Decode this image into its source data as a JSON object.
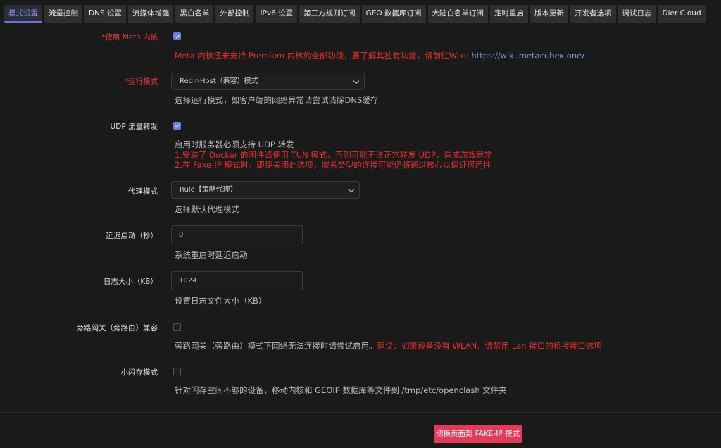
{
  "tabs": [
    {
      "label": "模式设置"
    },
    {
      "label": "流量控制"
    },
    {
      "label": "DNS 设置"
    },
    {
      "label": "流媒体增强"
    },
    {
      "label": "黑白名单"
    },
    {
      "label": "外部控制"
    },
    {
      "label": "IPv6 设置"
    },
    {
      "label": "第三方规则订阅"
    },
    {
      "label": "GEO 数据库订阅"
    },
    {
      "label": "大陆白名单订阅"
    },
    {
      "label": "定时重启"
    },
    {
      "label": "版本更新"
    },
    {
      "label": "开发者选项"
    },
    {
      "label": "调试日志"
    },
    {
      "label": "Dler Cloud"
    }
  ],
  "active_tab": "模式设置",
  "fields": {
    "meta": {
      "label": "*使用 Meta 内核",
      "checked": true,
      "desc_red": "Meta 内核还未支持 Premium 内核的全部功能，要了解其独有功能，请前往Wiki: ",
      "desc_link": "https://wiki.metacubex.one/"
    },
    "run_mode": {
      "label": "*运行模式",
      "value": "Redir-Host（兼容）模式",
      "desc": "选择运行模式，如客户端的网络异常请尝试清除DNS缓存"
    },
    "udp": {
      "label": "UDP 流量转发",
      "checked": true,
      "desc": "启用时服务器必须支持 UDP 转发",
      "warn1": "1.安装了 Docker 的固件请使用 TUN 模式，否则可能无法正常转发 UDP，造成游戏异常",
      "warn2": "2.在 Fake-IP 模式时，即使关闭此选项，域名类型的连接可能仍将通过核心以保证可用性"
    },
    "proxy_mode": {
      "label": "代理模式",
      "value": "Rule【策略代理】",
      "desc": "选择默认代理模式"
    },
    "start_delay": {
      "label": "延迟启动（秒）",
      "value": "0",
      "desc": "系统重启时延迟启动"
    },
    "log_size": {
      "label": "日志大小（KB）",
      "value": "1024",
      "desc": "设置日志文件大小（KB）"
    },
    "bypass_gateway": {
      "label": "旁路网关（旁路由）兼容",
      "checked": false,
      "desc": "旁路网关（旁路由）模式下网络无法连接时请尝试启用。",
      "desc_red": "建议：如果设备没有 WLAN，请禁用 Lan 接口的桥接接口选项"
    },
    "small_flash": {
      "label": "小闪存模式",
      "checked": false,
      "desc": "针对闪存空间不够的设备，移动内核和 GEOIP 数据库等文件到 /tmp/etc/openclash 文件夹"
    }
  },
  "switch_button": {
    "label": "切换页面到 FAKE-IP 模式"
  },
  "colors": {
    "accent": "#6c7ae0",
    "danger": "#e02f2f",
    "button": "#e73a5a",
    "background": "#1a1a1a"
  }
}
